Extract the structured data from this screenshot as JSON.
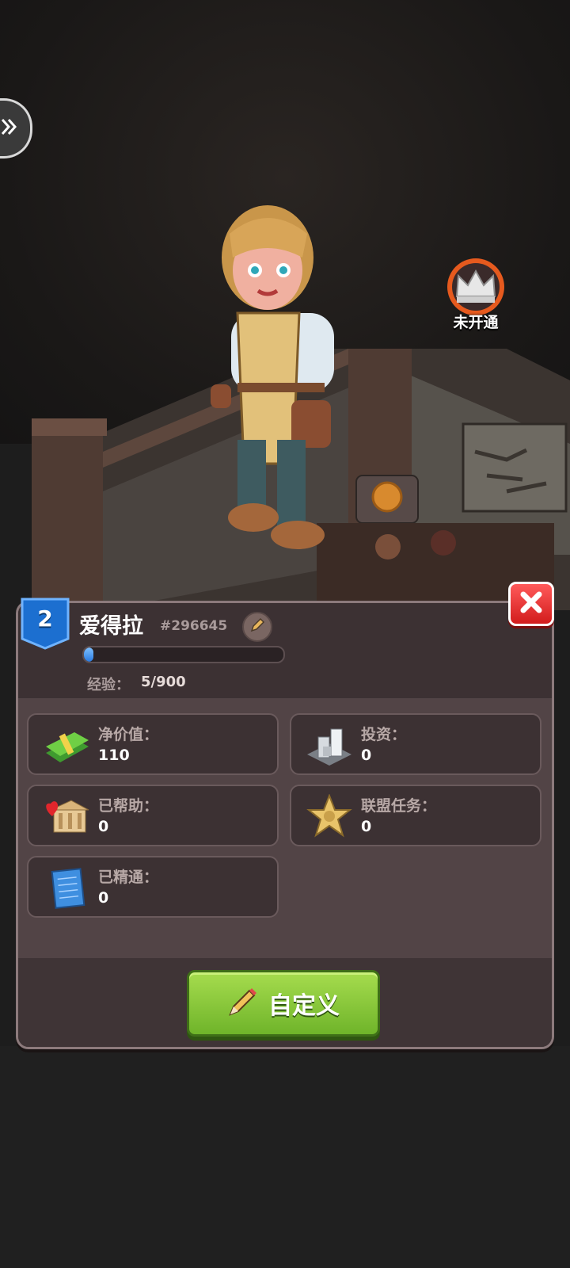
{
  "vip": {
    "label": "未开通"
  },
  "player": {
    "level": "2",
    "name": "爱得拉",
    "id": "#296645",
    "xp_label": "经验：",
    "xp_value": "5/900",
    "xp_progress": 0.006
  },
  "stats": [
    {
      "label": "净价值：",
      "value": "110",
      "icon": "cash-stack-icon"
    },
    {
      "label": "投资：",
      "value": "0",
      "icon": "building-complex-icon"
    },
    {
      "label": "已帮助：",
      "value": "0",
      "icon": "charity-bank-icon"
    },
    {
      "label": "联盟任务：",
      "value": "0",
      "icon": "sheriff-star-icon"
    },
    {
      "label": "已精通：",
      "value": "0",
      "icon": "blueprint-icon"
    }
  ],
  "actions": {
    "customize_label": "自定义"
  },
  "colors": {
    "panel": "#524446",
    "panel_dark": "#3c3133",
    "accent_green": "#8cc83a",
    "close_red": "#e02828",
    "level_blue": "#1c6fd0"
  }
}
